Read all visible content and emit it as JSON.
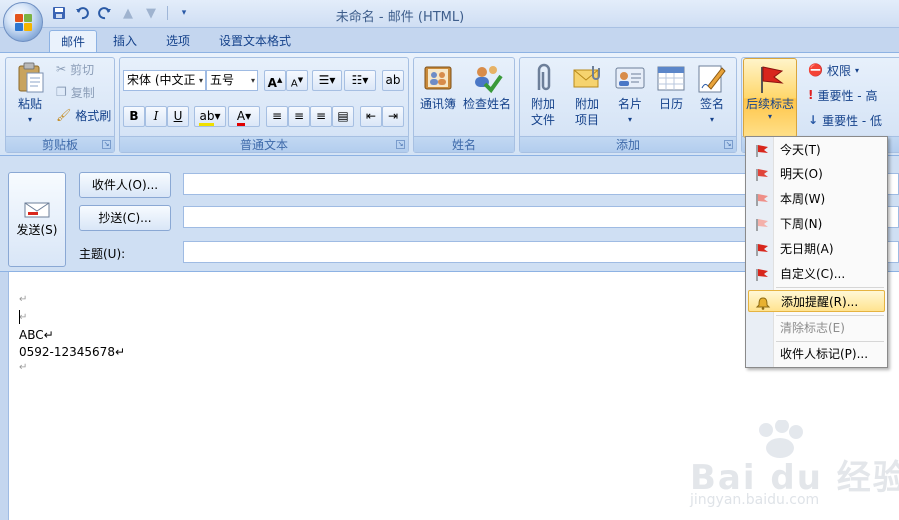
{
  "window": {
    "title": "未命名 - 邮件 (HTML)"
  },
  "tabs": [
    {
      "label": "邮件",
      "active": true
    },
    {
      "label": "插入",
      "active": false
    },
    {
      "label": "选项",
      "active": false
    },
    {
      "label": "设置文本格式",
      "active": false
    }
  ],
  "ribbon": {
    "clipboard": {
      "label": "剪贴板",
      "paste": "粘贴",
      "cut": "剪切",
      "copy": "复制",
      "format_painter": "格式刷"
    },
    "basic_text": {
      "label": "普通文本",
      "font": "宋体 (中文正",
      "size": "五号"
    },
    "names": {
      "label": "姓名",
      "address_book": "通讯簿",
      "check_names": "检查姓名"
    },
    "include": {
      "label": "添加",
      "attach_file": "附加文件",
      "attach_item": "附加项目",
      "business_card": "名片",
      "calendar": "日历",
      "signature": "签名"
    },
    "options": {
      "followup": "后续标志",
      "permission": "权限",
      "high_importance": "重要性 - 高",
      "low_importance": "重要性 - 低"
    }
  },
  "message": {
    "send": "发送(S)",
    "to": "收件人(O)...",
    "cc": "抄送(C)...",
    "subject_label": "主题(U):",
    "to_value": "",
    "cc_value": "",
    "subject_value": ""
  },
  "body": {
    "lines": [
      "↵",
      "↵",
      "ABC↵",
      "0592-12345678↵",
      "↵"
    ]
  },
  "followup_menu": {
    "items": [
      {
        "label": "今天(T)",
        "icon": "red-flag-icon"
      },
      {
        "label": "明天(O)",
        "icon": "red-flag-icon"
      },
      {
        "label": "本周(W)",
        "icon": "pink-flag-icon"
      },
      {
        "label": "下周(N)",
        "icon": "pink-flag-icon"
      },
      {
        "label": "无日期(A)",
        "icon": "red-flag-icon"
      },
      {
        "label": "自定义(C)...",
        "icon": "red-flag-icon"
      }
    ],
    "add_reminder": "添加提醒(R)...",
    "clear_flag": "清除标志(E)",
    "flag_for_recipients": "收件人标记(P)..."
  },
  "watermark": {
    "brand": "Bai du 经验",
    "url": "jingyan.baidu.com"
  },
  "colors": {
    "accent": "#15428b",
    "ribbon": "#dbe7f7",
    "highlight": "#ffe38f"
  }
}
